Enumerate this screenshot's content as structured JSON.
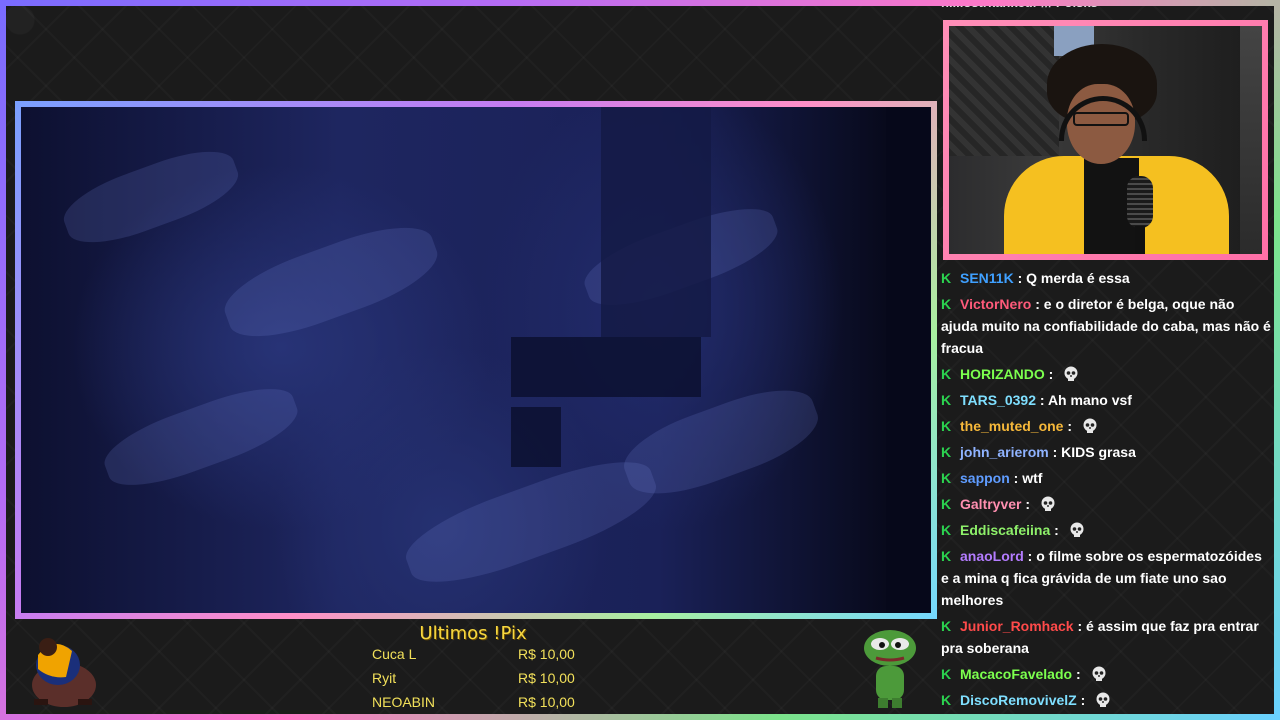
{
  "video": {
    "description_hidden": ""
  },
  "top_overflow_text": "ni...ostrkankeur /// Polsks",
  "pix": {
    "title": "Ultimos !Pix",
    "rows": [
      {
        "name": "Cuca L",
        "value": "R$ 10,00"
      },
      {
        "name": "Ryit",
        "value": "R$ 10,00"
      },
      {
        "name": "NEOABIN",
        "value": "R$ 10,00"
      }
    ]
  },
  "chat": {
    "badge_icon": "kick-badge-icon",
    "badge_color": "#2bd34f",
    "messages": [
      {
        "user": "SEN11K",
        "color": "#3fa0ff",
        "text": "Q merda é essa",
        "emote": ""
      },
      {
        "user": "VictorNero",
        "color": "#ff5a7a",
        "text": "e o diretor é belga, oque não ajuda muito na confiabilidade do caba, mas não é fracua",
        "emote": ""
      },
      {
        "user": "HORIZANDO",
        "color": "#7cff4e",
        "text": "",
        "emote": "skull-emote-icon"
      },
      {
        "user": "TARS_0392",
        "color": "#7fdfff",
        "text": "Ah mano vsf",
        "emote": ""
      },
      {
        "user": "the_muted_one",
        "color": "#f6b83a",
        "text": "",
        "emote": "skull-emote-icon"
      },
      {
        "user": "john_arierom",
        "color": "#8fb3ff",
        "text": "KIDS grasa",
        "emote": ""
      },
      {
        "user": "sappon",
        "color": "#5f9cff",
        "text": "wtf",
        "emote": ""
      },
      {
        "user": "Galtryver",
        "color": "#ff8fb0",
        "text": "",
        "emote": "skull-emote-icon"
      },
      {
        "user": "Eddiscafeiina",
        "color": "#8ef06a",
        "text": "",
        "emote": "skull-emote-icon"
      },
      {
        "user": "anaoLord",
        "color": "#b47cff",
        "text": "o filme sobre os espermatozóides e a mina q fica grávida de um fiate uno sao melhores",
        "emote": ""
      },
      {
        "user": "Junior_Romhack",
        "color": "#ff4a4a",
        "text": "é assim que faz pra entrar pra soberana",
        "emote": ""
      },
      {
        "user": "MacacoFavelado",
        "color": "#7cff4e",
        "text": "",
        "emote": "skull-emote-icon"
      },
      {
        "user": "DiscoRemovivelZ",
        "color": "#7fdfff",
        "text": "",
        "emote": "skull-emote-icon"
      }
    ]
  }
}
